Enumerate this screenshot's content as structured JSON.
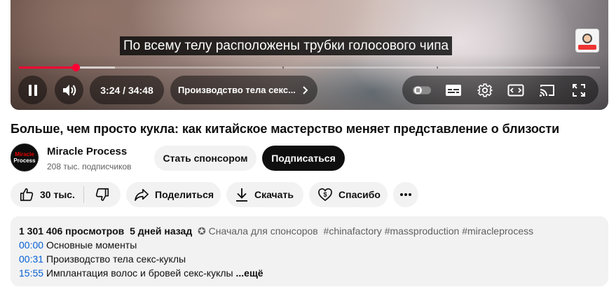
{
  "player": {
    "caption": "По всему телу расположены трубки голосового чипа",
    "time": "3:24 / 34:48",
    "chapter": "Производство тела секс...",
    "progress_fraction": 0.098,
    "buffered_fraction": 0.165
  },
  "video": {
    "title": "Больше, чем просто кукла: как китайское мастерство меняет представление о близости"
  },
  "channel": {
    "avatar_line1": "Miracle",
    "avatar_line2": "Process",
    "name": "Miracle Process",
    "subscribers": "208 тыс. подписчиков",
    "sponsor_label": "Стать спонсором",
    "subscribe_label": "Подписаться"
  },
  "actions": {
    "likes": "30 тыс.",
    "share": "Поделиться",
    "download": "Скачать",
    "thanks": "Спасибо"
  },
  "description": {
    "views": "1 301 406 просмотров",
    "date": "5 дней назад",
    "sponsor_first": "✪ Сначала для спонсоров",
    "tags": "#chinafactory #massproduction #miracleprocess",
    "chapters": [
      {
        "time": "00:00",
        "title": "Основные моменты"
      },
      {
        "time": "00:31",
        "title": "Производство тела секс-куклы"
      },
      {
        "time": "15:55",
        "title": "Имплантация волос и бровей секс-куклы"
      }
    ],
    "more": "...ещё"
  }
}
